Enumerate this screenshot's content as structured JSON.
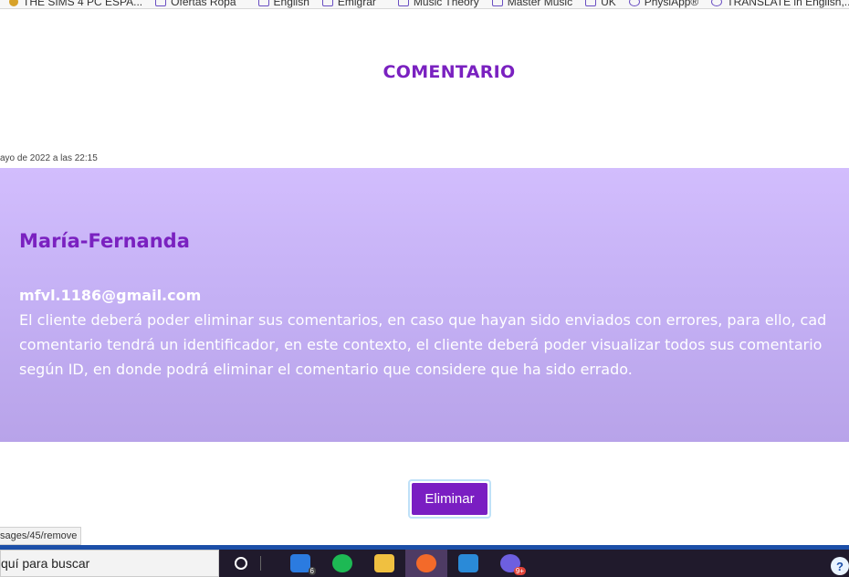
{
  "bookmarks": [
    {
      "label": "THE SIMS 4 PC ESPA...",
      "icon": "sims-icon"
    },
    {
      "label": "Ofertas Ropa",
      "icon": "folder-icon"
    },
    {
      "label": "English",
      "icon": "folder-icon"
    },
    {
      "label": "Emigrar",
      "icon": "folder-icon"
    },
    {
      "label": "Music Theory",
      "icon": "folder-icon"
    },
    {
      "label": "Master Music",
      "icon": "folder-icon"
    },
    {
      "label": "UK",
      "icon": "folder-icon"
    },
    {
      "label": "PhysiApp®",
      "icon": "globe-icon"
    },
    {
      "label": "TRANSLATE in English,...",
      "icon": "globe-icon"
    }
  ],
  "page": {
    "title": "COMENTARIO",
    "timestamp": "ayo de 2022 a las 22:15"
  },
  "comment": {
    "name": "María-Fernanda",
    "email": "mfvl.1186@gmail.com",
    "text_lines": [
      "El cliente deberá poder eliminar sus comentarios, en caso que hayan sido enviados con errores, para ello, cad",
      "comentario tendrá un identificador, en este contexto, el cliente deberá poder visualizar todos sus comentario",
      "según ID, en donde podrá eliminar el comentario que considere que ha sido errado."
    ]
  },
  "actions": {
    "delete_label": "Eliminar"
  },
  "status_url": "sages/45/remove",
  "taskbar": {
    "search_placeholder": "quí para buscar",
    "mail_badge": "6",
    "chrome_badge": "9+",
    "help_label": "?"
  },
  "colors": {
    "accent": "#7a21c0",
    "card_top": "#d2bdfd",
    "card_bottom": "#b8a3e9",
    "button": "#7a1ec2"
  }
}
